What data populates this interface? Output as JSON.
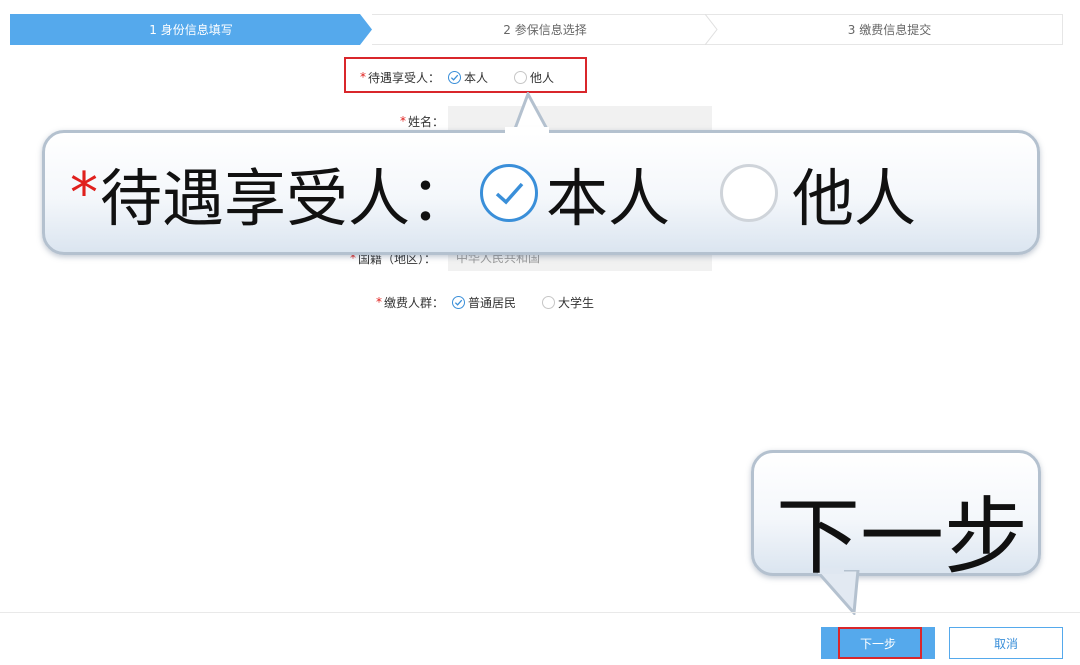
{
  "steps": [
    {
      "label": "1 身份信息填写"
    },
    {
      "label": "2 参保信息选择"
    },
    {
      "label": "3 缴费信息提交"
    }
  ],
  "form": {
    "beneficiary": {
      "required_mark": "*",
      "label": "待遇享受人：",
      "options": [
        "本人",
        "他人"
      ],
      "selected": "本人"
    },
    "name": {
      "required_mark": "*",
      "label": "姓名："
    },
    "nationality": {
      "required_mark": "*",
      "label": "国籍（地区）：",
      "value": "中华人民共和国"
    },
    "payer_group": {
      "required_mark": "*",
      "label": "缴费人群：",
      "options": [
        "普通居民",
        "大学生"
      ],
      "selected": "普通居民"
    }
  },
  "callout_beneficiary": {
    "required_mark": "*",
    "label": "待遇享受人：",
    "options": [
      "本人",
      "他人"
    ]
  },
  "callout_next": {
    "label": "下一步"
  },
  "buttons": {
    "next_label": "下一步",
    "cancel_label": "取消"
  },
  "colors": {
    "accent": "#55a9ec",
    "highlight": "#d9262b",
    "required": "#e0201d"
  }
}
